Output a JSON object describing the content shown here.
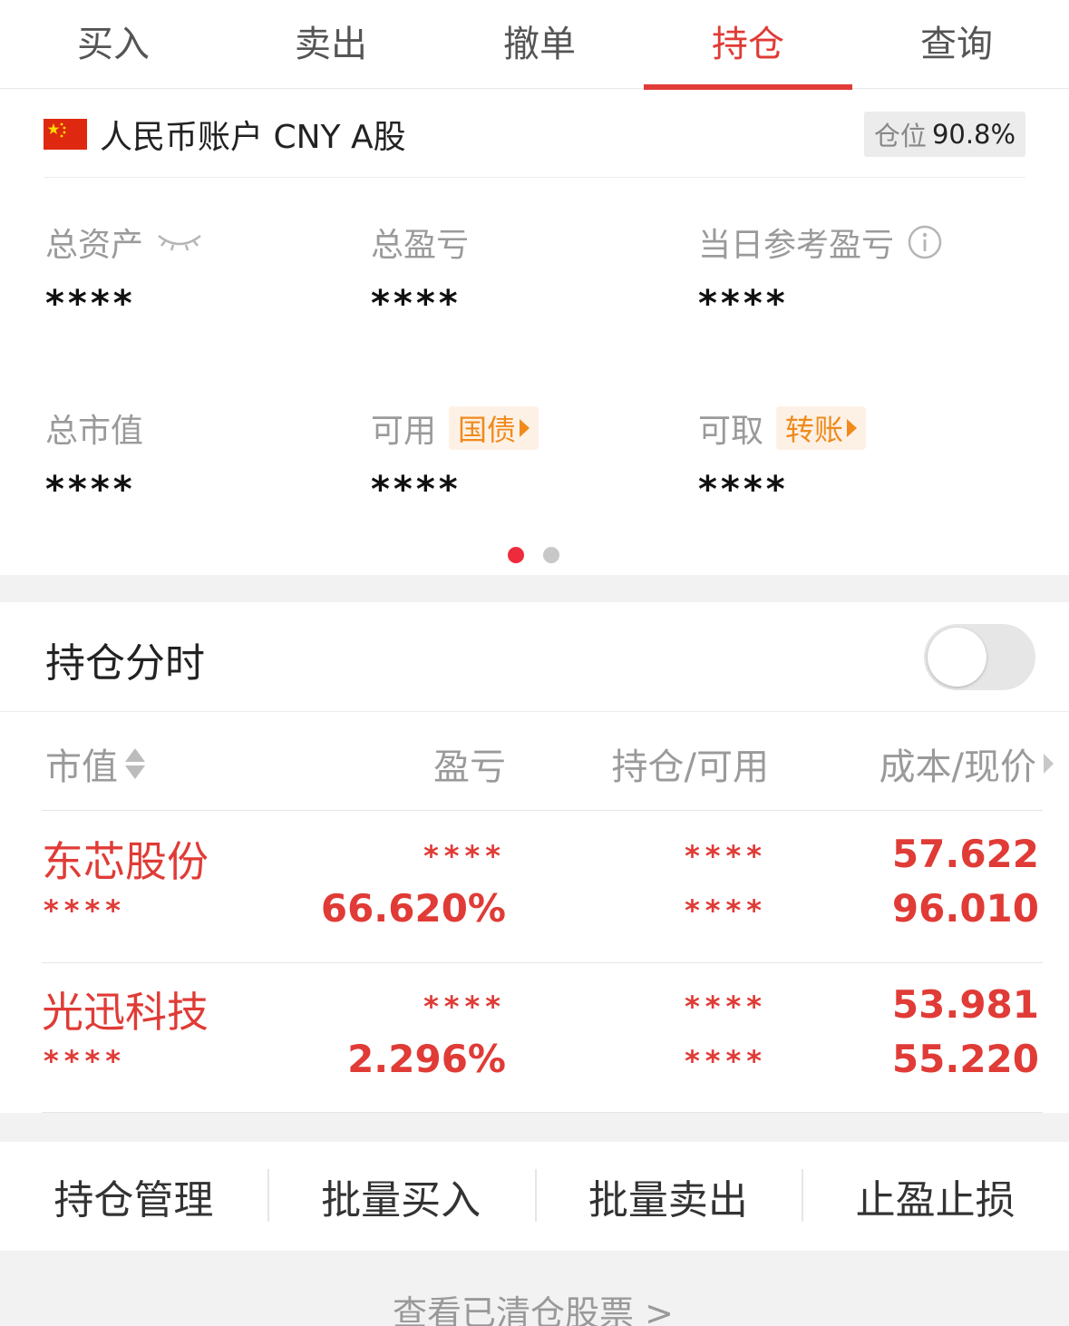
{
  "tabs": [
    {
      "label": "买入"
    },
    {
      "label": "卖出"
    },
    {
      "label": "撤单"
    },
    {
      "label": "持仓"
    },
    {
      "label": "查询"
    }
  ],
  "active_tab": "持仓",
  "account": {
    "label": "人民币账户 CNY A股",
    "position_label": "仓位",
    "position_value": "90.8%"
  },
  "stats": {
    "total_assets": {
      "label": "总资产",
      "value": "****"
    },
    "total_pnl": {
      "label": "总盈亏",
      "value": "****"
    },
    "daily_pnl": {
      "label": "当日参考盈亏",
      "value": "****"
    },
    "market_value": {
      "label": "总市值",
      "value": "****"
    },
    "available": {
      "label": "可用",
      "chip": "国债",
      "value": "****"
    },
    "withdrawable": {
      "label": "可取",
      "chip": "转账",
      "value": "****"
    }
  },
  "pager": {
    "pages": 2,
    "current": 1
  },
  "holding_timeshare": {
    "title": "持仓分时",
    "enabled": false
  },
  "table": {
    "headers": {
      "market_value": "市值",
      "pnl": "盈亏",
      "position": "持仓/可用",
      "cost": "成本/现价"
    },
    "rows": [
      {
        "name": "东芯股份",
        "market_value": "****",
        "pnl": "****",
        "pnl_pct": "66.620%",
        "position": "****",
        "available": "****",
        "cost": "57.622",
        "price": "96.010"
      },
      {
        "name": "光迅科技",
        "market_value": "****",
        "pnl": "****",
        "pnl_pct": "2.296%",
        "position": "****",
        "available": "****",
        "cost": "53.981",
        "price": "55.220"
      }
    ]
  },
  "actions": [
    {
      "label": "持仓管理"
    },
    {
      "label": "批量买入"
    },
    {
      "label": "批量卖出"
    },
    {
      "label": "止盈止损"
    }
  ],
  "footer": {
    "link": "查看已清仓股票 >"
  },
  "colors": {
    "accent": "#e03b36",
    "chip": "#f08a1c",
    "muted": "#9a9a9a"
  }
}
